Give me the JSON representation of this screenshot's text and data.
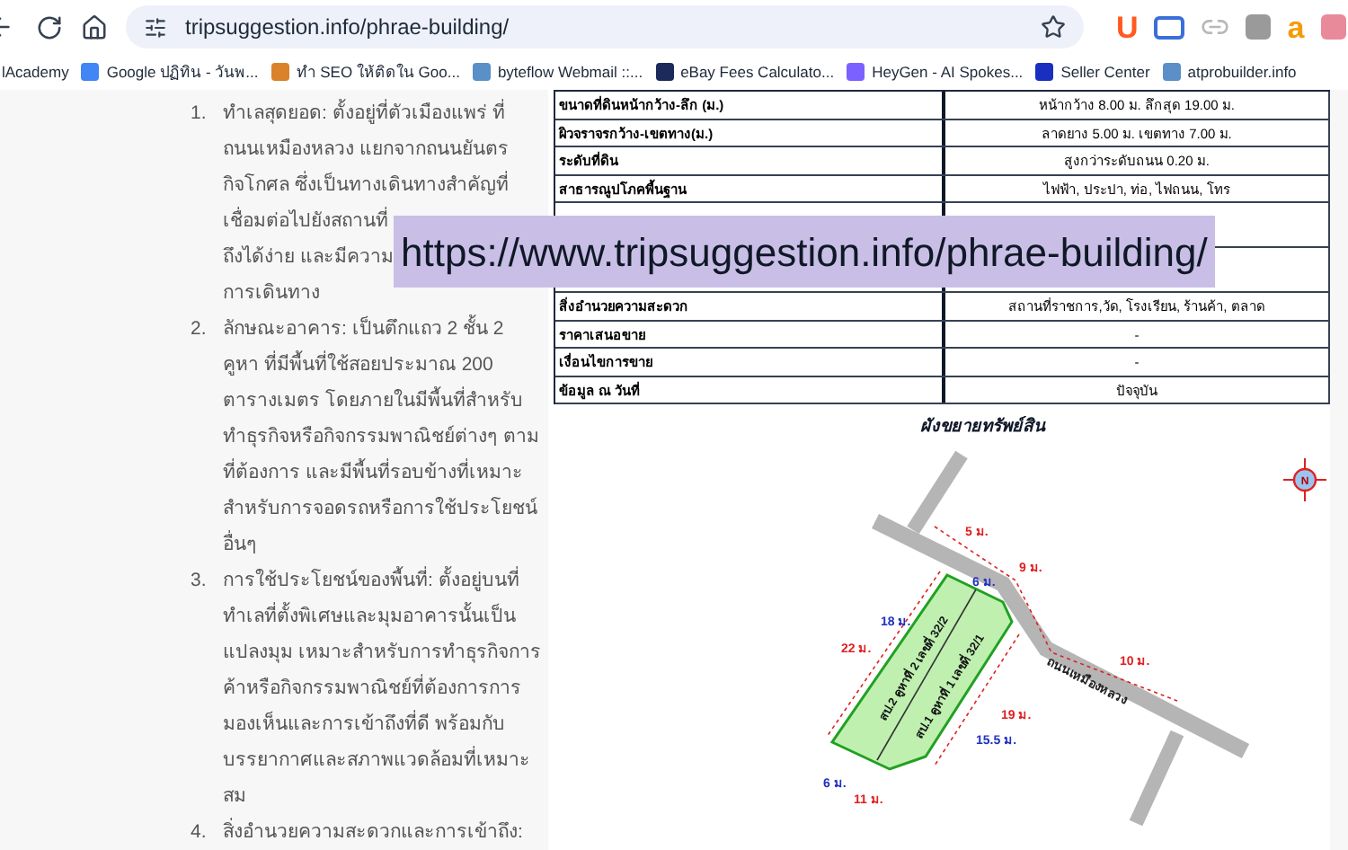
{
  "address_bar": {
    "url": "tripsuggestion.info/phrae-building/"
  },
  "extensions": [
    {
      "kind": "letter",
      "text": "U",
      "color": "#ff5a1f"
    },
    {
      "kind": "panel",
      "color": "#3b6fd8"
    },
    {
      "kind": "link",
      "color": "#b8b8b8"
    },
    {
      "kind": "square",
      "color": "#9a9a9a"
    },
    {
      "kind": "letter",
      "text": "a",
      "color": "#f59b00"
    },
    {
      "kind": "square",
      "color": "#e88a9a"
    }
  ],
  "bookmarks": [
    {
      "label": "lAcademy"
    },
    {
      "label": "Google ปฏิทิน - วันพ...",
      "color": "#4285f4"
    },
    {
      "label": "ทำ SEO ให้ติดใน Goo...",
      "color": "#d9822b"
    },
    {
      "label": "byteflow Webmail ::...",
      "color": "#5a8fc8"
    },
    {
      "label": "eBay Fees Calculato...",
      "color": "#1b2a5a"
    },
    {
      "label": "HeyGen - AI Spokes...",
      "color": "#7b61ff"
    },
    {
      "label": "Seller Center",
      "color": "#1a2fbf"
    },
    {
      "label": "atprobuilder.info",
      "color": "#5a8fc8"
    }
  ],
  "article": {
    "items": [
      {
        "number": "1.",
        "segments": [
          "ทำเลสุดยอด: ตั้งอยู่ที่ตัวเมืองแพร่ ที่",
          "ถนนเหมืองหลวง แยกจากถนนยันตร",
          "กิจโกศล ซึ่งเป็นทางเดินทางสำคัญที่",
          "เชื่อมต่อไปยังสถานที่",
          "ถึงได้ง่าย และมีความ",
          "การเดินทาง"
        ]
      },
      {
        "number": "2.",
        "text": "ลักษณะอาคาร: เป็นตึกแถว 2 ชั้น 2 คูหา ที่มีพื้นที่ใช้สอยประมาณ 200 ตารางเมตร โดยภายในมีพื้นที่สำหรับทำธุรกิจหรือกิจกรรมพาณิชย์ต่างๆ ตามที่ต้องการ และมีพื้นที่รอบข้างที่เหมาะสำหรับการจอดรถหรือการใช้ประโยชน์อื่นๆ"
      },
      {
        "number": "3.",
        "text": "การใช้ประโยชน์ของพื้นที่: ตั้งอยู่บนที่ทำเลที่ตั้งพิเศษและมุมอาคารนั้นเป็นแปลงมุม เหมาะสำหรับการทำธุรกิจการค้าหรือกิจกรรมพาณิชย์ที่ต้องการการมองเห็นและการเข้าถึงที่ดี พร้อมกับบรรยากาศและสภาพแวดล้อมที่เหมาะสม"
      },
      {
        "number": "4.",
        "text": "สิ่งอำนวยความสะดวกและการเข้าถึง:"
      }
    ]
  },
  "property_table": {
    "rows": [
      {
        "kind": "row",
        "label": "ขนาดที่ดินหน้ากว้าง-ลึก (ม.)",
        "value": "หน้ากว้าง 8.00 ม. ลึกสุด 19.00  ม."
      },
      {
        "kind": "row",
        "label": "ผิวจราจรกว้าง-เขตทาง(ม.)",
        "value": "ลาดยาง 5.00 ม. เขตทาง 7.00 ม."
      },
      {
        "kind": "row",
        "label": "ระดับที่ดิน",
        "value": "สูงกว่าระดับถนน 0.20 ม."
      },
      {
        "kind": "row",
        "label": "สาธารณูปโภคพื้นฐาน",
        "value": "ไฟฟ้า, ประปา, ท่อ, ไฟถนน, โทร"
      },
      {
        "kind": "covered"
      },
      {
        "kind": "covered"
      },
      {
        "kind": "row",
        "label": "สิ่งอำนวยความสะดวก",
        "value": "สถานที่ราชการ,วัด, โรงเรียน, ร้านค้า, ตลาด"
      },
      {
        "kind": "row",
        "label": "ราคาเสนอขาย",
        "value": "-"
      },
      {
        "kind": "row",
        "label": "เงื่อนไขการขาย",
        "value": "-"
      },
      {
        "kind": "row",
        "label": "ข้อมูล ณ วันที่",
        "value": "ปัจจุบัน"
      }
    ]
  },
  "site_plan": {
    "title": "ผังขยายทรัพย์สิน",
    "road_name": "ถนนเหมืองหลวง",
    "parcels": [
      "สป.2 คูหาที่ 2 เลขที่ 32/2",
      "สป.1 คูหาที่ 1 เลขที่ 32/1"
    ],
    "compass": "N",
    "measurements": [
      {
        "text": "5 ม.",
        "color": "#e02020"
      },
      {
        "text": "9 ม.",
        "color": "#e02020"
      },
      {
        "text": "10 ม.",
        "color": "#e02020"
      },
      {
        "text": "22 ม.",
        "color": "#e02020"
      },
      {
        "text": "18 ม.",
        "color": "#2030c0"
      },
      {
        "text": "6 ม.",
        "color": "#2030c0"
      },
      {
        "text": "19 ม.",
        "color": "#e02020"
      },
      {
        "text": "15.5 ม.",
        "color": "#2030c0"
      },
      {
        "text": "6 ม.",
        "color": "#2030c0"
      },
      {
        "text": "11 ม.",
        "color": "#e02020"
      }
    ]
  },
  "overlay_banner": {
    "text": "https://www.tripsuggestion.info/phrae-building/"
  }
}
